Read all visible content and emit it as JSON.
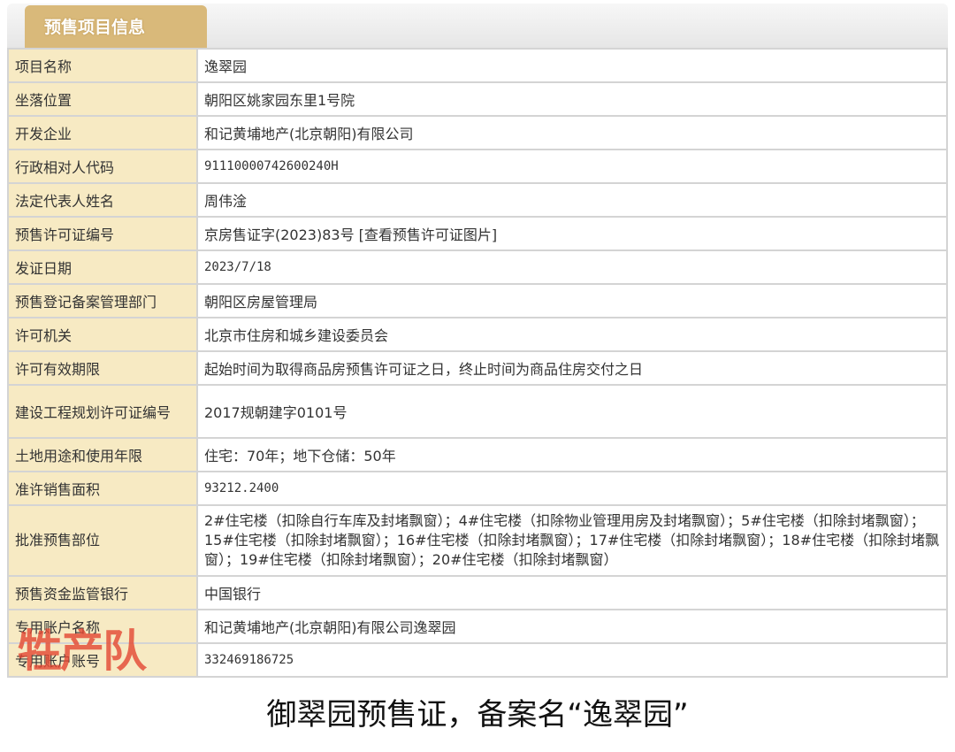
{
  "tab_title": "预售项目信息",
  "rows": [
    {
      "label": "项目名称",
      "value": "逸翠园"
    },
    {
      "label": "坐落位置",
      "value": "朝阳区姚家园东里1号院"
    },
    {
      "label": "开发企业",
      "value": "和记黄埔地产(北京朝阳)有限公司"
    },
    {
      "label": "行政相对人代码",
      "value": "91110000742600240H"
    },
    {
      "label": "法定代表人姓名",
      "value": "周伟淦"
    },
    {
      "label": "预售许可证编号",
      "value": "京房售证字(2023)83号 [查看预售许可证图片]"
    },
    {
      "label": "发证日期",
      "value": "2023/7/18"
    },
    {
      "label": "预售登记备案管理部门",
      "value": "朝阳区房屋管理局"
    },
    {
      "label": "许可机关",
      "value": "北京市住房和城乡建设委员会"
    },
    {
      "label": "许可有效期限",
      "value": "起始时间为取得商品房预售许可证之日，终止时间为商品住房交付之日"
    },
    {
      "label": "建设工程规划许可证编号",
      "value": "2017规朝建字0101号"
    },
    {
      "label": "土地用途和使用年限",
      "value": "住宅：70年；地下仓储：50年"
    },
    {
      "label": "准许销售面积",
      "value": "93212.2400"
    },
    {
      "label": "批准预售部位",
      "value": "2#住宅楼（扣除自行车库及封堵飘窗）；4#住宅楼（扣除物业管理用房及封堵飘窗）；5#住宅楼（扣除封堵飘窗）；15#住宅楼（扣除封堵飘窗）；16#住宅楼（扣除封堵飘窗）；17#住宅楼（扣除封堵飘窗）；18#住宅楼（扣除封堵飘窗）；19#住宅楼（扣除封堵飘窗）；20#住宅楼（扣除封堵飘窗）"
    },
    {
      "label": "预售资金监管银行",
      "value": "中国银行"
    },
    {
      "label": "专用账户名称",
      "value": "和记黄埔地产(北京朝阳)有限公司逸翠园"
    },
    {
      "label": "专用账户账号",
      "value": "332469186725"
    }
  ],
  "watermark": "牲产队",
  "caption": "御翠园预售证，备案名“逸翠园”"
}
